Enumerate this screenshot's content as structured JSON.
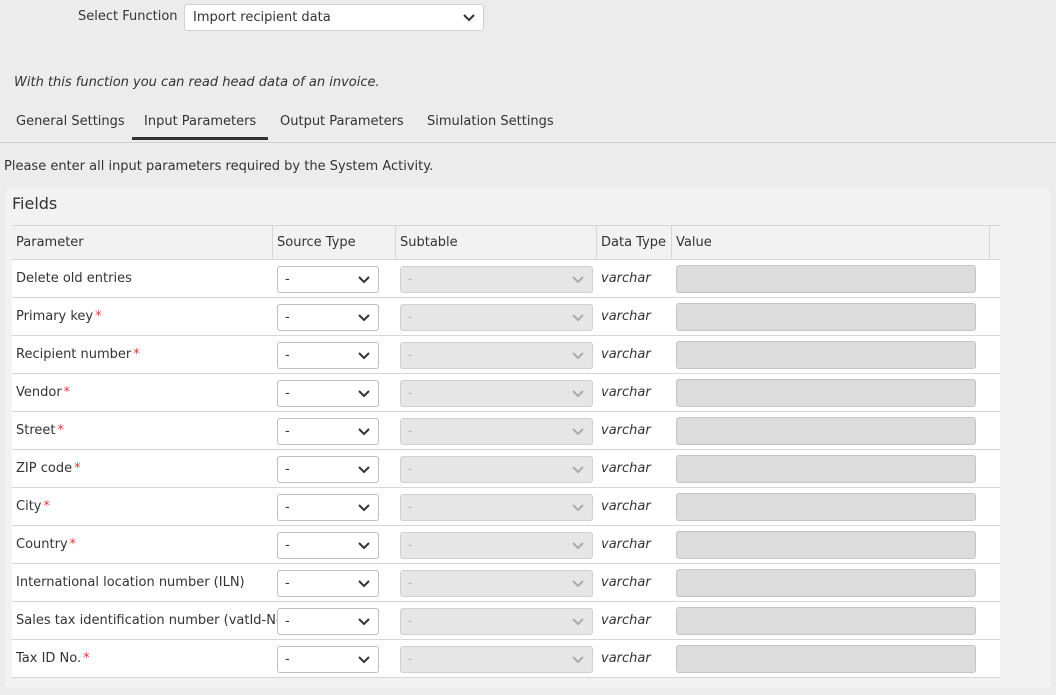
{
  "function_selector": {
    "label": "Select Function",
    "value": "Import recipient data"
  },
  "description": "With this function you can read head data of an invoice.",
  "tabs": [
    {
      "label": "General Settings",
      "active": false
    },
    {
      "label": "Input Parameters",
      "active": true
    },
    {
      "label": "Output Parameters",
      "active": false
    },
    {
      "label": "Simulation Settings",
      "active": false
    }
  ],
  "intro": "Please enter all input parameters required by the System Activity.",
  "fields": {
    "title": "Fields",
    "columns": [
      "Parameter",
      "Source Type",
      "Subtable",
      "Data Type",
      "Value"
    ],
    "rows": [
      {
        "parameter": "Delete old entries",
        "required": false,
        "source_type": "-",
        "subtable": "-",
        "data_type": "varchar",
        "value": ""
      },
      {
        "parameter": "Primary key",
        "required": true,
        "source_type": "-",
        "subtable": "-",
        "data_type": "varchar",
        "value": ""
      },
      {
        "parameter": "Recipient number",
        "required": true,
        "source_type": "-",
        "subtable": "-",
        "data_type": "varchar",
        "value": ""
      },
      {
        "parameter": "Vendor",
        "required": true,
        "source_type": "-",
        "subtable": "-",
        "data_type": "varchar",
        "value": ""
      },
      {
        "parameter": "Street",
        "required": true,
        "source_type": "-",
        "subtable": "-",
        "data_type": "varchar",
        "value": ""
      },
      {
        "parameter": "ZIP code",
        "required": true,
        "source_type": "-",
        "subtable": "-",
        "data_type": "varchar",
        "value": ""
      },
      {
        "parameter": "City",
        "required": true,
        "source_type": "-",
        "subtable": "-",
        "data_type": "varchar",
        "value": ""
      },
      {
        "parameter": "Country",
        "required": true,
        "source_type": "-",
        "subtable": "-",
        "data_type": "varchar",
        "value": ""
      },
      {
        "parameter": "International location number (ILN)",
        "required": false,
        "source_type": "-",
        "subtable": "-",
        "data_type": "varchar",
        "value": ""
      },
      {
        "parameter": "Sales tax identification number (vatId-No)",
        "required": true,
        "source_type": "-",
        "subtable": "-",
        "data_type": "varchar",
        "value": ""
      },
      {
        "parameter": "Tax ID No.",
        "required": true,
        "source_type": "-",
        "subtable": "-",
        "data_type": "varchar",
        "value": ""
      }
    ]
  },
  "required_marker": "*",
  "colors": {
    "background": "#ececec",
    "required": "#e0393e",
    "active_tab_underline": "#333333",
    "disabled_field": "#dcdcdc"
  }
}
